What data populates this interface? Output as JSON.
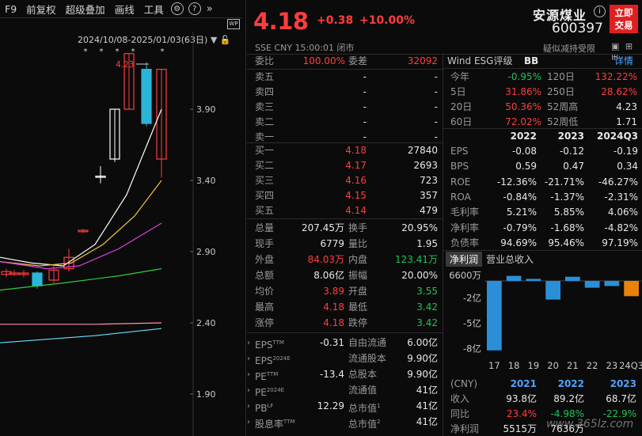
{
  "toolbar": {
    "items": [
      "F9",
      "前复权",
      "超级叠加",
      "画线",
      "工具"
    ]
  },
  "chart": {
    "range_label": "2024/10/08-2025/01/03(63日)",
    "high_label": "4.23",
    "price_ticks": [
      "3.90",
      "3.40",
      "2.90",
      "2.40",
      "1.90"
    ],
    "colors": {
      "up": "#ff3d3d",
      "down": "#2bb5d8",
      "ma5": "#ffffff",
      "ma10": "#f5c242",
      "ma20": "#e040e0",
      "ma60": "#2ecc40",
      "line_pink": "#ff8fb0",
      "line_cyan": "#66e0ff"
    }
  },
  "quote": {
    "price": "4.18",
    "change": "+0.38",
    "change_pct": "+10.00%",
    "meta": "SSE  CNY  15:00:01  闭市",
    "name": "安源煤业",
    "code": "600397",
    "trade_btn": [
      "立即",
      "交易"
    ],
    "risk": "疑似减持受限"
  },
  "order_book": {
    "weibi_label": "委比",
    "weibi": "100.00%",
    "weicha_label": "委差",
    "weicha": "32092",
    "asks": [
      {
        "label": "卖五",
        "price": "-",
        "vol": "-"
      },
      {
        "label": "卖四",
        "price": "-",
        "vol": "-"
      },
      {
        "label": "卖三",
        "price": "-",
        "vol": "-"
      },
      {
        "label": "卖二",
        "price": "-",
        "vol": "-"
      },
      {
        "label": "卖一",
        "price": "-",
        "vol": "-"
      }
    ],
    "bids": [
      {
        "label": "买一",
        "price": "4.18",
        "vol": "27840"
      },
      {
        "label": "买二",
        "price": "4.17",
        "vol": "2693"
      },
      {
        "label": "买三",
        "price": "4.16",
        "vol": "723"
      },
      {
        "label": "买四",
        "price": "4.15",
        "vol": "357"
      },
      {
        "label": "买五",
        "price": "4.14",
        "vol": "479"
      }
    ]
  },
  "stats": [
    {
      "l1": "总量",
      "v1": "207.45万",
      "c1": "white",
      "l2": "换手",
      "v2": "20.95%",
      "c2": "white"
    },
    {
      "l1": "现手",
      "v1": "6779",
      "c1": "white",
      "l2": "量比",
      "v2": "1.95",
      "c2": "white"
    },
    {
      "l1": "外盘",
      "v1": "84.03万",
      "c1": "red",
      "l2": "内盘",
      "v2": "123.41万",
      "c2": "green"
    },
    {
      "l1": "总额",
      "v1": "8.06亿",
      "c1": "white",
      "l2": "振幅",
      "v2": "20.00%",
      "c2": "white"
    },
    {
      "l1": "均价",
      "v1": "3.89",
      "c1": "red",
      "l2": "开盘",
      "v2": "3.55",
      "c2": "green"
    },
    {
      "l1": "最高",
      "v1": "4.18",
      "c1": "red",
      "l2": "最低",
      "v2": "3.42",
      "c2": "green"
    },
    {
      "l1": "涨停",
      "v1": "4.18",
      "c1": "red",
      "l2": "跌停",
      "v2": "3.42",
      "c2": "green"
    }
  ],
  "valuation": [
    {
      "l1": "EPS",
      "s1": "TTM",
      "v1": "-0.31",
      "l2": "自由流通",
      "s2": "",
      "v2": "6.00亿"
    },
    {
      "l1": "EPS",
      "s1": "2024E",
      "v1": "",
      "l2": "流通股本",
      "s2": "",
      "v2": "9.90亿"
    },
    {
      "l1": "PE",
      "s1": "TTM",
      "v1": "-13.4",
      "l2": "总股本",
      "s2": "",
      "v2": "9.90亿"
    },
    {
      "l1": "PE",
      "s1": "2024E",
      "v1": "",
      "l2": "流通值",
      "s2": "",
      "v2": "41亿"
    },
    {
      "l1": "PB",
      "s1": "LF",
      "v1": "12.29",
      "l2": "总市值",
      "s2": "1",
      "v2": "41亿"
    },
    {
      "l1": "股息率",
      "s1": "TTM",
      "v1": "",
      "l2": "总市值",
      "s2": "2",
      "v2": "41亿"
    }
  ],
  "wind": {
    "title": "Wind ESG评级",
    "rating": "BB",
    "detail": "详情"
  },
  "returns": [
    {
      "l1": "今年",
      "v1": "-0.95%",
      "c1": "green",
      "l2": "120日",
      "v2": "132.22%",
      "c2": "red"
    },
    {
      "l1": "5日",
      "v1": "31.86%",
      "c1": "red",
      "l2": "250日",
      "v2": "28.62%",
      "c2": "red"
    },
    {
      "l1": "20日",
      "v1": "50.36%",
      "c1": "red",
      "l2": "52周高",
      "v2": "4.23",
      "c2": "white"
    },
    {
      "l1": "60日",
      "v1": "72.02%",
      "c1": "red",
      "l2": "52周低",
      "v2": "1.71",
      "c2": "white"
    }
  ],
  "fundamentals": {
    "years": [
      "2022",
      "2023",
      "2024Q3"
    ],
    "rows": [
      {
        "label": "EPS",
        "vals": [
          "-0.08",
          "-0.12",
          "-0.19"
        ]
      },
      {
        "label": "BPS",
        "vals": [
          "0.59",
          "0.47",
          "0.34"
        ]
      },
      {
        "label": "ROE",
        "vals": [
          "-12.36%",
          "-21.71%",
          "-46.27%"
        ]
      },
      {
        "label": "ROA",
        "vals": [
          "-0.84%",
          "-1.37%",
          "-2.31%"
        ]
      },
      {
        "label": "毛利率",
        "vals": [
          "5.21%",
          "5.85%",
          "4.06%"
        ]
      },
      {
        "label": "净利率",
        "vals": [
          "-0.79%",
          "-1.68%",
          "-4.82%"
        ]
      },
      {
        "label": "负债率",
        "vals": [
          "94.69%",
          "95.46%",
          "97.19%"
        ]
      }
    ]
  },
  "profit_tabs": [
    "净利润",
    "营业总收入"
  ],
  "chart_data": {
    "type": "bar",
    "categories": [
      "17",
      "18",
      "19",
      "20",
      "21",
      "22",
      "23",
      "24Q3"
    ],
    "values": [
      -8.2,
      0.6,
      0.25,
      -2.2,
      0.5,
      -0.8,
      -0.6,
      -1.8
    ],
    "ytick_labels": [
      "6600万",
      "-2亿",
      "-5亿",
      "-8亿"
    ],
    "ylim": [
      -8.5,
      0.66
    ],
    "colors": {
      "negative": "#2a8fd8",
      "positive": "#2a8fd8",
      "highlight": "#e8820c"
    }
  },
  "income": {
    "unit": "(CNY)",
    "years": [
      "2021",
      "2022",
      "2023"
    ],
    "rows": [
      {
        "label": "收入",
        "vals": [
          "93.8亿",
          "89.2亿",
          "68.7亿"
        ],
        "colors": [
          "white",
          "white",
          "white"
        ]
      },
      {
        "label": "同比",
        "vals": [
          "23.4%",
          "-4.98%",
          "-22.9%"
        ],
        "colors": [
          "red",
          "green",
          "green"
        ]
      },
      {
        "label": "净利润",
        "vals": [
          "5515万",
          "7636万",
          ""
        ],
        "colors": [
          "white",
          "white",
          "white"
        ]
      }
    ],
    "watermark": "www.365lz.com"
  }
}
